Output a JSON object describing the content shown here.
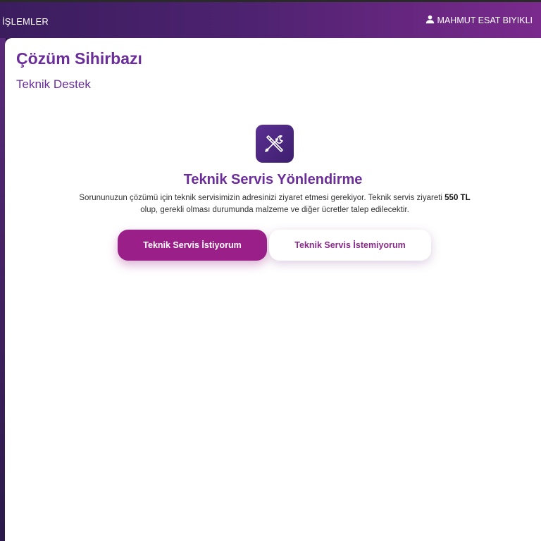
{
  "topbar": {
    "menu_label": "İŞLEMLER",
    "user_name": "MAHMUT ESAT BIYIKLI",
    "user_icon": "user-icon"
  },
  "header": {
    "title": "Çözüm Sihirbazı",
    "subtitle": "Teknik Destek"
  },
  "service": {
    "icon": "tools-icon",
    "title": "Teknik Servis Yönlendirme",
    "description_part1": "Sorununuzun çözümü için teknik servisimizin adresinizi ziyaret etmesi gerekiyor. Teknik servis ziyareti ",
    "price": "550 TL",
    "description_part2": " olup, gerekli olması durumunda malzeme ve diğer ücretler talep edilecektir."
  },
  "actions": {
    "accept_label": "Teknik Servis İstiyorum",
    "decline_label": "Teknik Servis İstemiyorum"
  },
  "colors": {
    "accent": "#6a2d9a",
    "button_primary": "#9a1f88"
  }
}
